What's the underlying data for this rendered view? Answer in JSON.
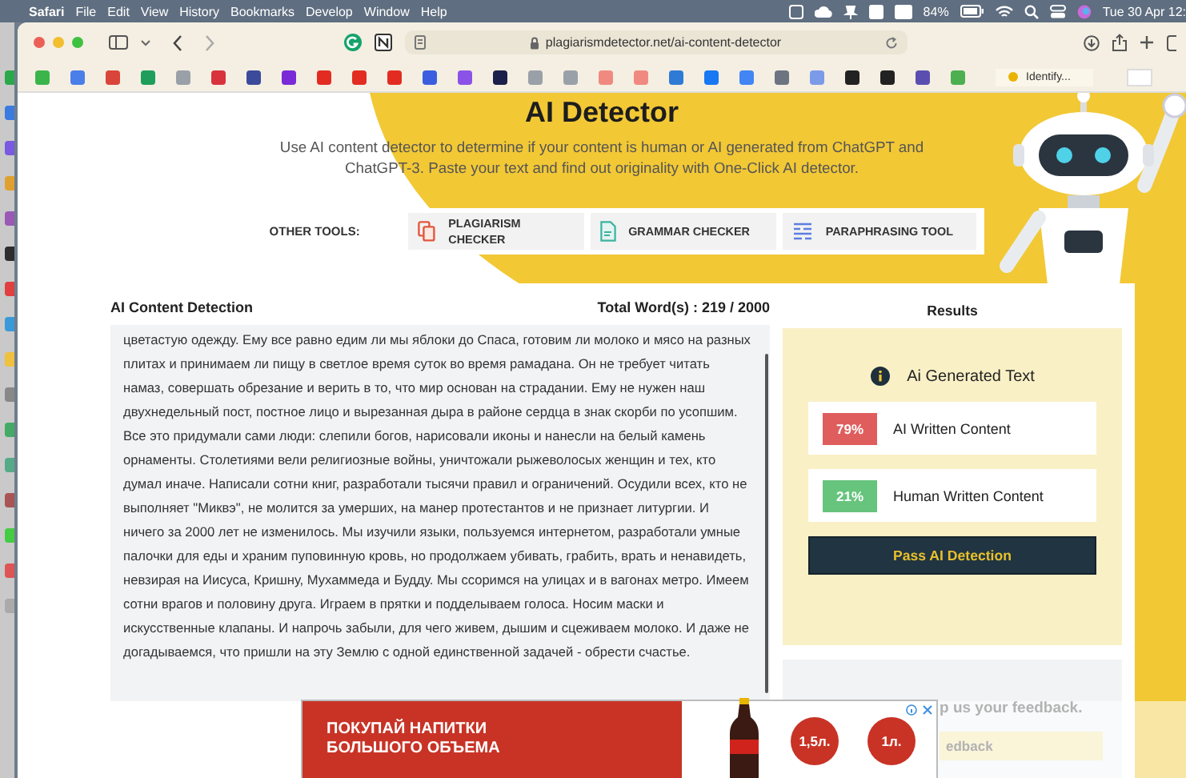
{
  "menu_bar": {
    "app": "Safari",
    "items": [
      "File",
      "Edit",
      "View",
      "History",
      "Bookmarks",
      "Develop",
      "Window",
      "Help"
    ],
    "battery": "84%",
    "clock": "Tue 30 Apr 12:"
  },
  "browser": {
    "url": "plagiarismdetector.net/ai-content-detector",
    "tab": "Identify..."
  },
  "page": {
    "title": "AI Detector",
    "description": "Use AI content detector to determine if your content is human or AI generated from ChatGPT and ChatGPT-3. Paste your text and find out originality with One-Click AI detector.",
    "other_tools_label": "OTHER TOOLS:",
    "tools": [
      {
        "label": "PLAGIARISM CHECKER",
        "kind": "plagiarism"
      },
      {
        "label": "GRAMMAR CHECKER",
        "kind": "grammar"
      },
      {
        "label": "PARAPHRASING TOOL",
        "kind": "paraphrase"
      }
    ]
  },
  "detection": {
    "heading": "AI Content Detection",
    "word_count": "Total Word(s) : 219 / 2000",
    "text": "цветастую одежду. Ему все равно едим ли мы яблоки до Спаса, готовим ли молоко и мясо на разных плитах и принимаем ли пищу в светлое время суток во время рамадана. Он не требует читать намаз, совершать обрезание и верить в то, что мир основан на страдании. Ему не нужен наш двухнедельный пост, постное лицо и вырезанная дыра в районе сердца в знак скорби по усопшим. Все это придумали сами люди: слепили богов, нарисовали иконы и нанесли на белый камень орнаменты. Столетиями вели религиозные войны, уничтожали рыжеволосых женщин и тех, кто думал иначе. Написали сотни книг, разработали тысячи правил и ограничений. Осудили всех, кто не выполняет \"Миквэ\", не молится за умерших, на манер протестантов и не признает литургии. И ничего за 2000 лет не изменилось. Мы изучили языки, пользуемся интернетом, разработали умные палочки для еды и храним пуповинную кровь, но продолжаем убивать, грабить, врать и ненавидеть, невзирая на Иисуса, Кришну, Мухаммеда и Будду. Мы ссоримся на улицах и в вагонах метро. Имеем сотни врагов и половину друга. Играем в прятки и подделываем голоса. Носим маски и искусственные клапаны. И напрочь забыли, для чего живем, дышим и сцеживаем молоко. И даже не догадываемся, что пришли на эту Землю с одной единственной задачей - обрести счастье."
  },
  "results": {
    "heading": "Results",
    "verdict": "Ai Generated Text",
    "scores": [
      {
        "value": "79%",
        "label": "AI Written Content",
        "color": "#e05d5d"
      },
      {
        "value": "21%",
        "label": "Human Written Content",
        "color": "#66c47c"
      }
    ],
    "button": "Pass AI Detection"
  },
  "feedback": {
    "text": "p us your feedback.",
    "button": "edback"
  },
  "ad": {
    "headline": "ПОКУПАЙ НАПИТКИ БОЛЬШОГО ОБЪЕМА",
    "sizes": [
      "1,5л.",
      "1л."
    ]
  }
}
